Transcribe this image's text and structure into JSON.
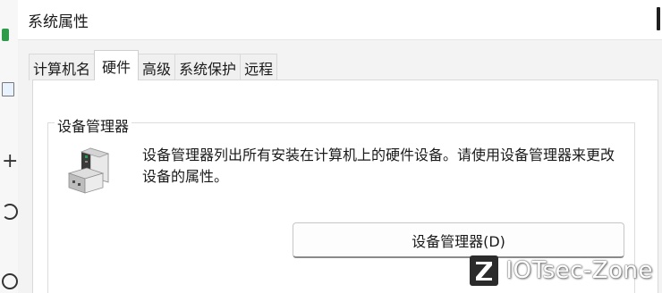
{
  "window": {
    "title": "系统属性"
  },
  "tabs": [
    {
      "label": "计算机名",
      "active": false
    },
    {
      "label": "硬件",
      "active": true
    },
    {
      "label": "高级",
      "active": false
    },
    {
      "label": "系统保护",
      "active": false
    },
    {
      "label": "远程",
      "active": false
    }
  ],
  "device_manager": {
    "group_title": "设备管理器",
    "description": "设备管理器列出所有安装在计算机上的硬件设备。请使用设备管理器来更改设备的属性。",
    "button_label": "设备管理器(D)",
    "icon": "device-manager-icon"
  },
  "watermark": {
    "text": "IOTsec-Zone",
    "logo_letter": "Z"
  },
  "colors": {
    "accent_green": "#21a34a",
    "panel_bg": "#ffffff",
    "dialog_bg": "#f3f3f3"
  }
}
